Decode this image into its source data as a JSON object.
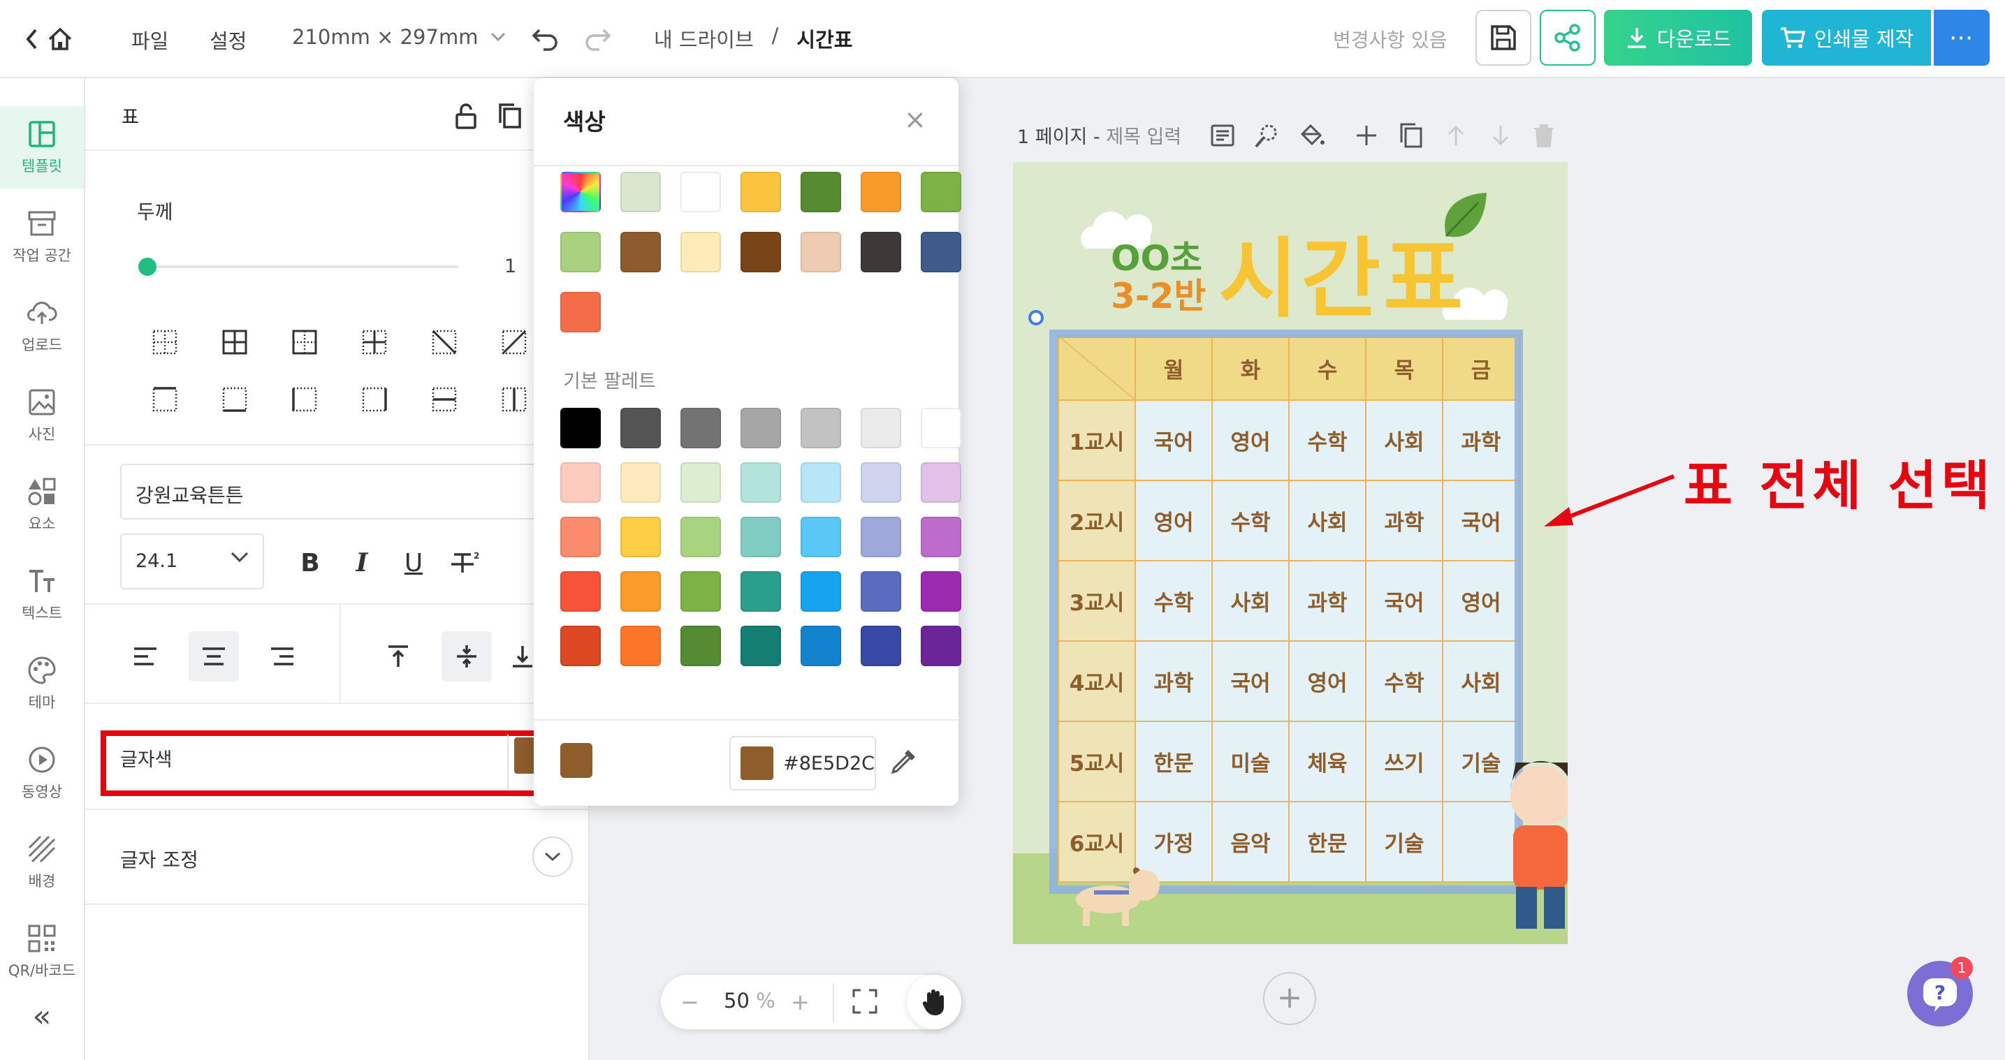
{
  "topbar": {
    "file_menu": "파일",
    "settings_menu": "설정",
    "page_size": "210mm × 297mm",
    "breadcrumb_root": "내 드라이브",
    "breadcrumb_sep": "/",
    "breadcrumb_current": "시간표",
    "status": "변경사항 있음",
    "download_label": "다운로드",
    "print_label": "인쇄물 제작",
    "more_label": "⋯",
    "accent_green": "#25c28e",
    "accent_blue": "#2e86e6"
  },
  "rail": {
    "items": [
      {
        "label": "템플릿",
        "icon": "template-icon",
        "active": true
      },
      {
        "label": "작업 공간",
        "icon": "archive-icon"
      },
      {
        "label": "업로드",
        "icon": "upload-cloud-icon"
      },
      {
        "label": "사진",
        "icon": "image-icon"
      },
      {
        "label": "요소",
        "icon": "shapes-icon"
      },
      {
        "label": "텍스트",
        "icon": "text-icon"
      },
      {
        "label": "테마",
        "icon": "palette-icon"
      },
      {
        "label": "동영상",
        "icon": "play-icon"
      },
      {
        "label": "배경",
        "icon": "background-pattern-icon"
      },
      {
        "label": "QR/바코드",
        "icon": "qr-icon"
      }
    ],
    "collapse": "«"
  },
  "panel": {
    "title": "표",
    "thickness_label": "두께",
    "thickness_value": "1",
    "thickness_fraction": 0.0,
    "font_name": "강원교육튼튼",
    "font_size": "24.1",
    "bold": "B",
    "italic": "I",
    "underline": "U",
    "text_color_label": "글자색",
    "text_color": "#8E5D2C",
    "text_adjust_label": "글자 조정"
  },
  "color_popup": {
    "title": "색상",
    "close": "×",
    "document_colors": [
      "rainbow",
      "#d9e8cc",
      "#ffffff",
      "#fbc43e",
      "#568b32",
      "#f79c2a",
      "#7cb246",
      "#a8d27f",
      "#8d5b2d",
      "#fdebb8",
      "#7a4419",
      "#efcbb1",
      "#3e3838",
      "#3e5b8a",
      "#f36e48"
    ],
    "palette_label": "기본 팔레트",
    "palette_rows": [
      [
        "#000000",
        "#545454",
        "#737373",
        "#a6a6a6",
        "#c2c2c2",
        "#ebebeb",
        "#ffffff"
      ],
      [
        "#fdcbbd",
        "#fdebbf",
        "#dcedd0",
        "#b3e3dd",
        "#b7e6f8",
        "#cfd4ef",
        "#e2c1e8"
      ],
      [
        "#fb8b6d",
        "#fdcd43",
        "#a8d47f",
        "#81ccc3",
        "#5ac8f7",
        "#9fa8da",
        "#bd6ccb"
      ],
      [
        "#f75338",
        "#fb9b2c",
        "#7cb246",
        "#2a9f8e",
        "#17a4ee",
        "#5b6cc0",
        "#9b2bb0"
      ],
      [
        "#dd4722",
        "#fd7527",
        "#558b32",
        "#137e71",
        "#1383d0",
        "#3748a7",
        "#6c2599"
      ]
    ],
    "current_hex": "#8E5D2C"
  },
  "canvas": {
    "page_label": "1 페이지 - ",
    "page_title_placeholder": "제목 입력",
    "add_page": "+",
    "annotation": "표 전체 선택"
  },
  "artboard": {
    "school": "OO초",
    "class": "3-2반",
    "title": "시간표",
    "table": {
      "header": [
        "",
        "월",
        "화",
        "수",
        "목",
        "금"
      ],
      "rows": [
        [
          "1교시",
          "국어",
          "영어",
          "수학",
          "사회",
          "과학"
        ],
        [
          "2교시",
          "영어",
          "수학",
          "사회",
          "과학",
          "국어"
        ],
        [
          "3교시",
          "수학",
          "사회",
          "과학",
          "국어",
          "영어"
        ],
        [
          "4교시",
          "과학",
          "국어",
          "영어",
          "수학",
          "사회"
        ],
        [
          "5교시",
          "한문",
          "미술",
          "체육",
          "쓰기",
          "기술"
        ],
        [
          "6교시",
          "가정",
          "음악",
          "한문",
          "기술",
          ""
        ]
      ]
    }
  },
  "zoom": {
    "minus": "−",
    "value": "50",
    "unit": "%",
    "plus": "+"
  },
  "help": {
    "badge": "1"
  }
}
